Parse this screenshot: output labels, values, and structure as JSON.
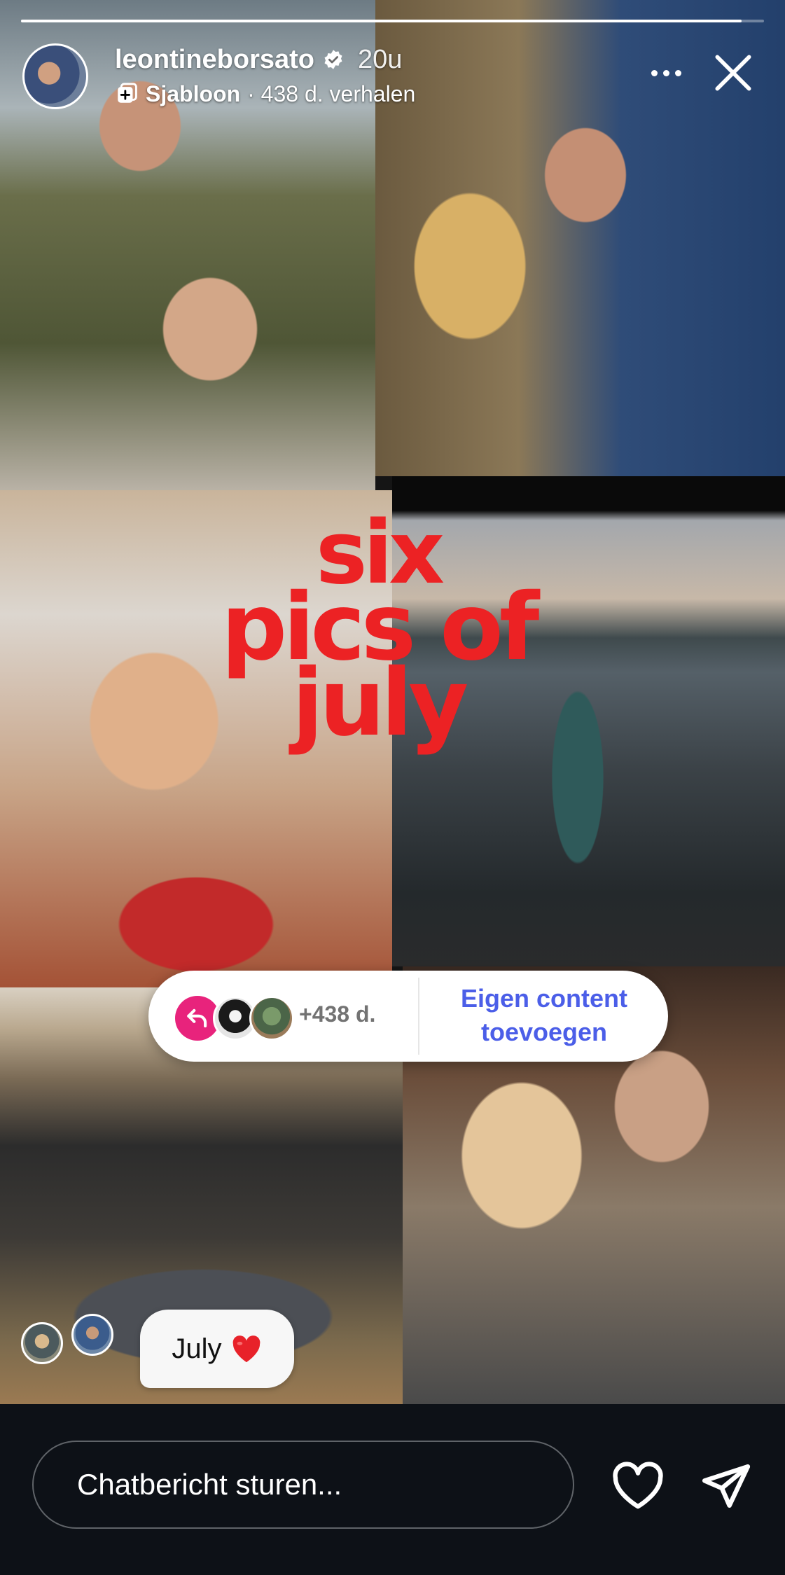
{
  "story": {
    "username": "leontineborsato",
    "time_ago": "20u",
    "template_label": "Sjabloon",
    "template_meta": "· 438 d. verhalen",
    "progress": 0.97,
    "overlay_title_line1": "six",
    "overlay_title_line2": "pics of",
    "overlay_title_line3": "july",
    "overlay_color": "#ec2224",
    "caption": "July",
    "caption_emoji": "red-heart"
  },
  "template_pill": {
    "count": "+438 d.",
    "cta_line1": "Eigen content",
    "cta_line2": "toevoegen",
    "accent": "#e8237c",
    "cta_color": "#4b5ee8"
  },
  "reply": {
    "placeholder": "Chatbericht sturen..."
  },
  "icons": {
    "verified": "verified-badge-icon",
    "template": "template-icon",
    "more": "more-options-icon",
    "close": "close-icon",
    "reply_arrow": "reply-arrow-icon",
    "like": "heart-icon",
    "send": "send-icon"
  }
}
